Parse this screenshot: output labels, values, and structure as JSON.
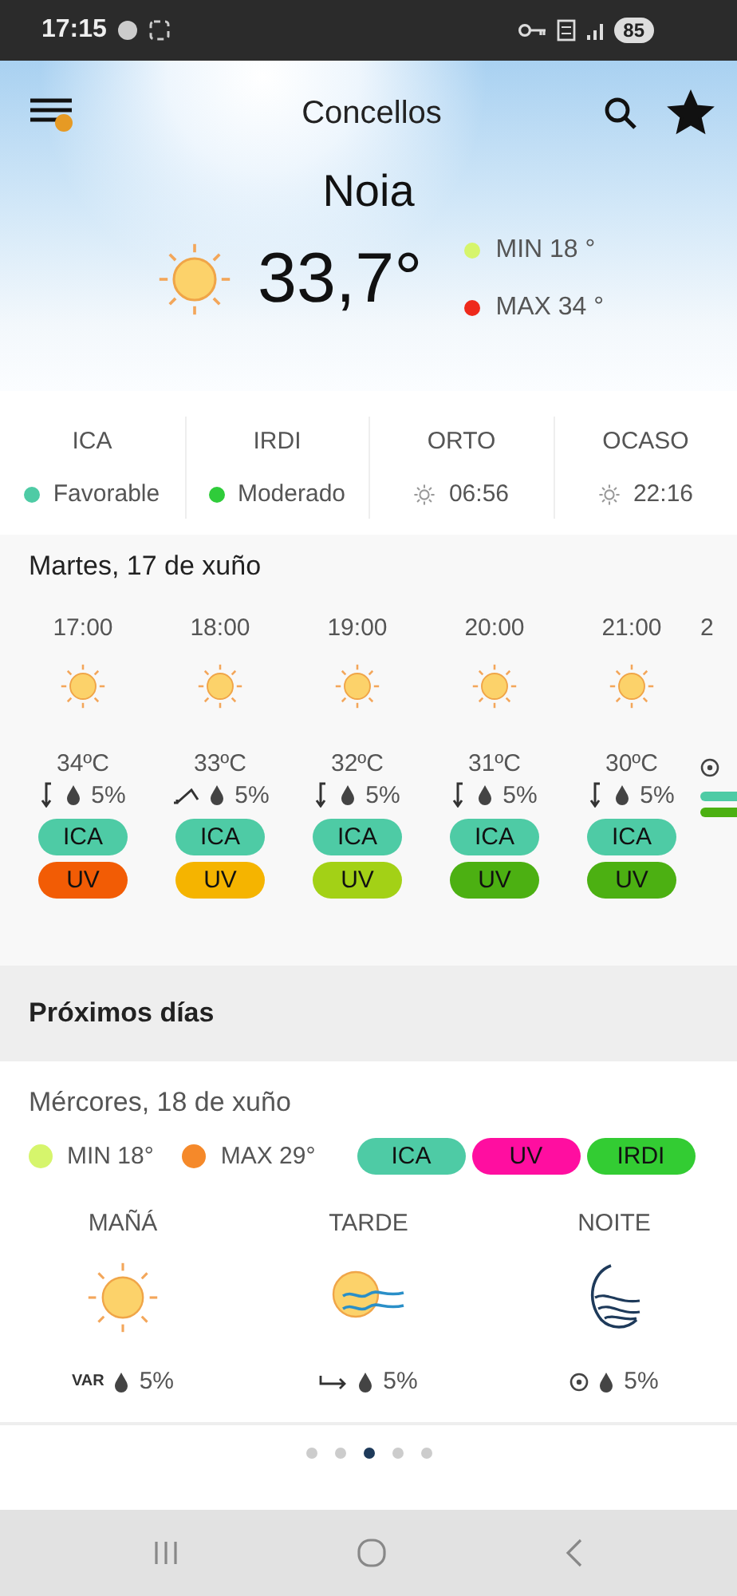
{
  "status_bar": {
    "time": "17:15",
    "battery": "85"
  },
  "header": {
    "title": "Concellos",
    "favorite": true
  },
  "location": "Noia",
  "current": {
    "weather": {
      "kind": "sun"
    },
    "temperature": "33,7°",
    "limits": [
      {
        "label": "MIN 18 °",
        "color": "#d6f56c"
      },
      {
        "label": "MAX 34 °",
        "color": "#ee2a1c"
      }
    ]
  },
  "indices": [
    {
      "title": "ICA",
      "kind": "dot",
      "value": "Favorable",
      "color": "#4ecba5"
    },
    {
      "title": "IRDI",
      "kind": "dot",
      "value": "Moderado",
      "color": "#2fcc3a"
    },
    {
      "title": "ORTO",
      "kind": "sun",
      "value": "06:56"
    },
    {
      "title": "OCASO",
      "kind": "sun",
      "value": "22:16"
    }
  ],
  "today": {
    "title": "Martes, 17 de xuño",
    "hours": [
      {
        "time": "17:00",
        "weather": {
          "kind": "sun"
        },
        "temperature": "34ºC",
        "wind": {
          "kind": "down"
        },
        "rain": "5%",
        "chips": [
          {
            "label": "ICA",
            "color": "#4ecba5"
          },
          {
            "label": "UV",
            "color": "#f25c05"
          }
        ]
      },
      {
        "time": "18:00",
        "weather": {
          "kind": "sun"
        },
        "temperature": "33ºC",
        "wind": {
          "kind": "diagonal"
        },
        "rain": "5%",
        "chips": [
          {
            "label": "ICA",
            "color": "#4ecba5"
          },
          {
            "label": "UV",
            "color": "#f5b400"
          }
        ]
      },
      {
        "time": "19:00",
        "weather": {
          "kind": "sun"
        },
        "temperature": "32ºC",
        "wind": {
          "kind": "down"
        },
        "rain": "5%",
        "chips": [
          {
            "label": "ICA",
            "color": "#4ecba5"
          },
          {
            "label": "UV",
            "color": "#a3d116"
          }
        ]
      },
      {
        "time": "20:00",
        "weather": {
          "kind": "sun"
        },
        "temperature": "31ºC",
        "wind": {
          "kind": "down"
        },
        "rain": "5%",
        "chips": [
          {
            "label": "ICA",
            "color": "#4ecba5"
          },
          {
            "label": "UV",
            "color": "#4cb012"
          }
        ]
      },
      {
        "time": "21:00",
        "weather": {
          "kind": "sun"
        },
        "temperature": "30ºC",
        "wind": {
          "kind": "down"
        },
        "rain": "5%",
        "chips": [
          {
            "label": "ICA",
            "color": "#4ecba5"
          },
          {
            "label": "UV",
            "color": "#4cb012"
          }
        ]
      },
      {
        "time": "2",
        "wind": {
          "kind": "calm"
        },
        "chips": [
          {
            "color": "#4ecba5"
          },
          {
            "color": "#4cb012"
          }
        ]
      }
    ]
  },
  "upcoming": {
    "title": "Próximos días",
    "days": [
      {
        "date": "Mércores, 18 de xuño",
        "limits": [
          {
            "label": "MIN 18°",
            "color": "#d6f56c"
          },
          {
            "label": "MAX 29°",
            "color": "#f5892a"
          }
        ],
        "chips": [
          {
            "label": "ICA",
            "color": "#4ecba5"
          },
          {
            "label": "UV",
            "color": "#ff0ea0"
          },
          {
            "label": "IRDI",
            "color": "#33cc33"
          }
        ],
        "periods": [
          {
            "name": "MAÑÁ",
            "weather": {
              "kind": "sun"
            },
            "wind": {
              "kind": "text",
              "label": "VAR"
            },
            "rain": "5%"
          },
          {
            "name": "TARDE",
            "weather": {
              "kind": "windysun"
            },
            "wind": {
              "kind": "right"
            },
            "rain": "5%"
          },
          {
            "name": "NOITE",
            "weather": {
              "kind": "windymoon"
            },
            "wind": {
              "kind": "calm"
            },
            "rain": "5%"
          }
        ]
      }
    ]
  },
  "pager": [
    {
      "selected": false
    },
    {
      "selected": false
    },
    {
      "selected": true
    },
    {
      "selected": false
    },
    {
      "selected": false
    }
  ]
}
